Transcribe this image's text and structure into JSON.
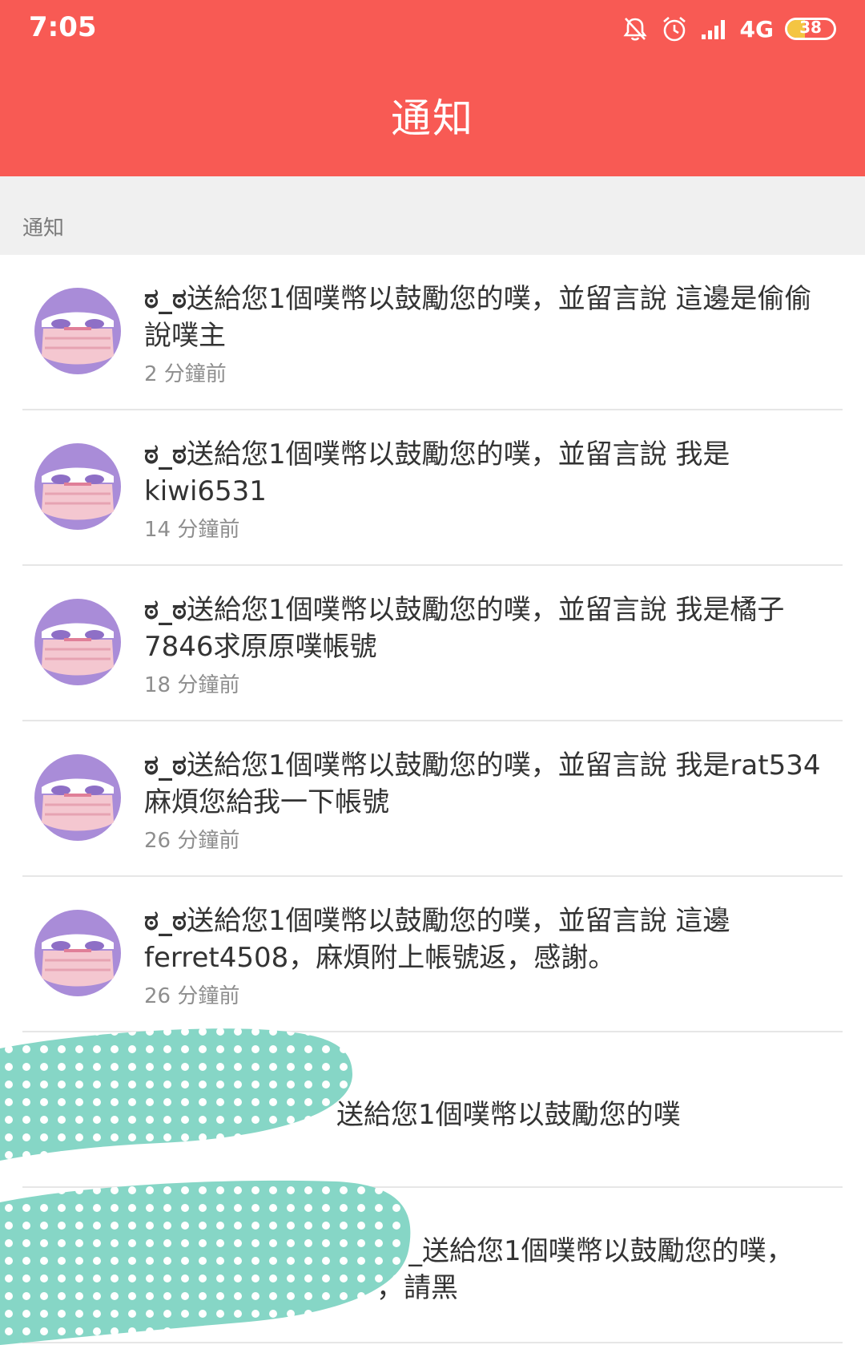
{
  "status_bar": {
    "time": "7:05",
    "network": "4G",
    "battery": "38",
    "battery_level_percent": 38,
    "icons": [
      "notifications-off-icon",
      "alarm-icon",
      "signal-icon",
      "battery-icon"
    ]
  },
  "header": {
    "title": "通知"
  },
  "section": {
    "label": "通知"
  },
  "colors": {
    "header": "#f85a54",
    "section_bg": "#f0f0f0",
    "avatar_purple": "#a98cd8",
    "avatar_mask": "#f4c7d0",
    "scribble": "#86d6c6"
  },
  "notifications": [
    {
      "sender": "ಠ_ಠ",
      "message": "送給您1個噗幣以鼓勵您的噗，並留言說 這邊是偷偷說噗主",
      "time": "2 分鐘前"
    },
    {
      "sender": "ಠ_ಠ",
      "message": "送給您1個噗幣以鼓勵您的噗，並留言說 我是kiwi6531",
      "time": "14 分鐘前"
    },
    {
      "sender": "ಠ_ಠ",
      "message": "送給您1個噗幣以鼓勵您的噗，並留言說 我是橘子7846求原原噗帳號",
      "time": "18 分鐘前"
    },
    {
      "sender": "ಠ_ಠ",
      "message": "送給您1個噗幣以鼓勵您的噗，並留言說 我是rat534 麻煩您給我一下帳號",
      "time": "26 分鐘前"
    },
    {
      "sender": "ಠ_ಠ",
      "message": "送給您1個噗幣以鼓勵您的噗，並留言說 這邊ferret4508，麻煩附上帳號返，感謝。",
      "time": "26 分鐘前"
    }
  ],
  "obscured_notifications": [
    {
      "message": "送給您1個噗幣以鼓勵您的噗"
    },
    {
      "message": "_送給您1個噗幣以鼓勵您的噗，",
      "message_line2": "，請黑"
    }
  ]
}
